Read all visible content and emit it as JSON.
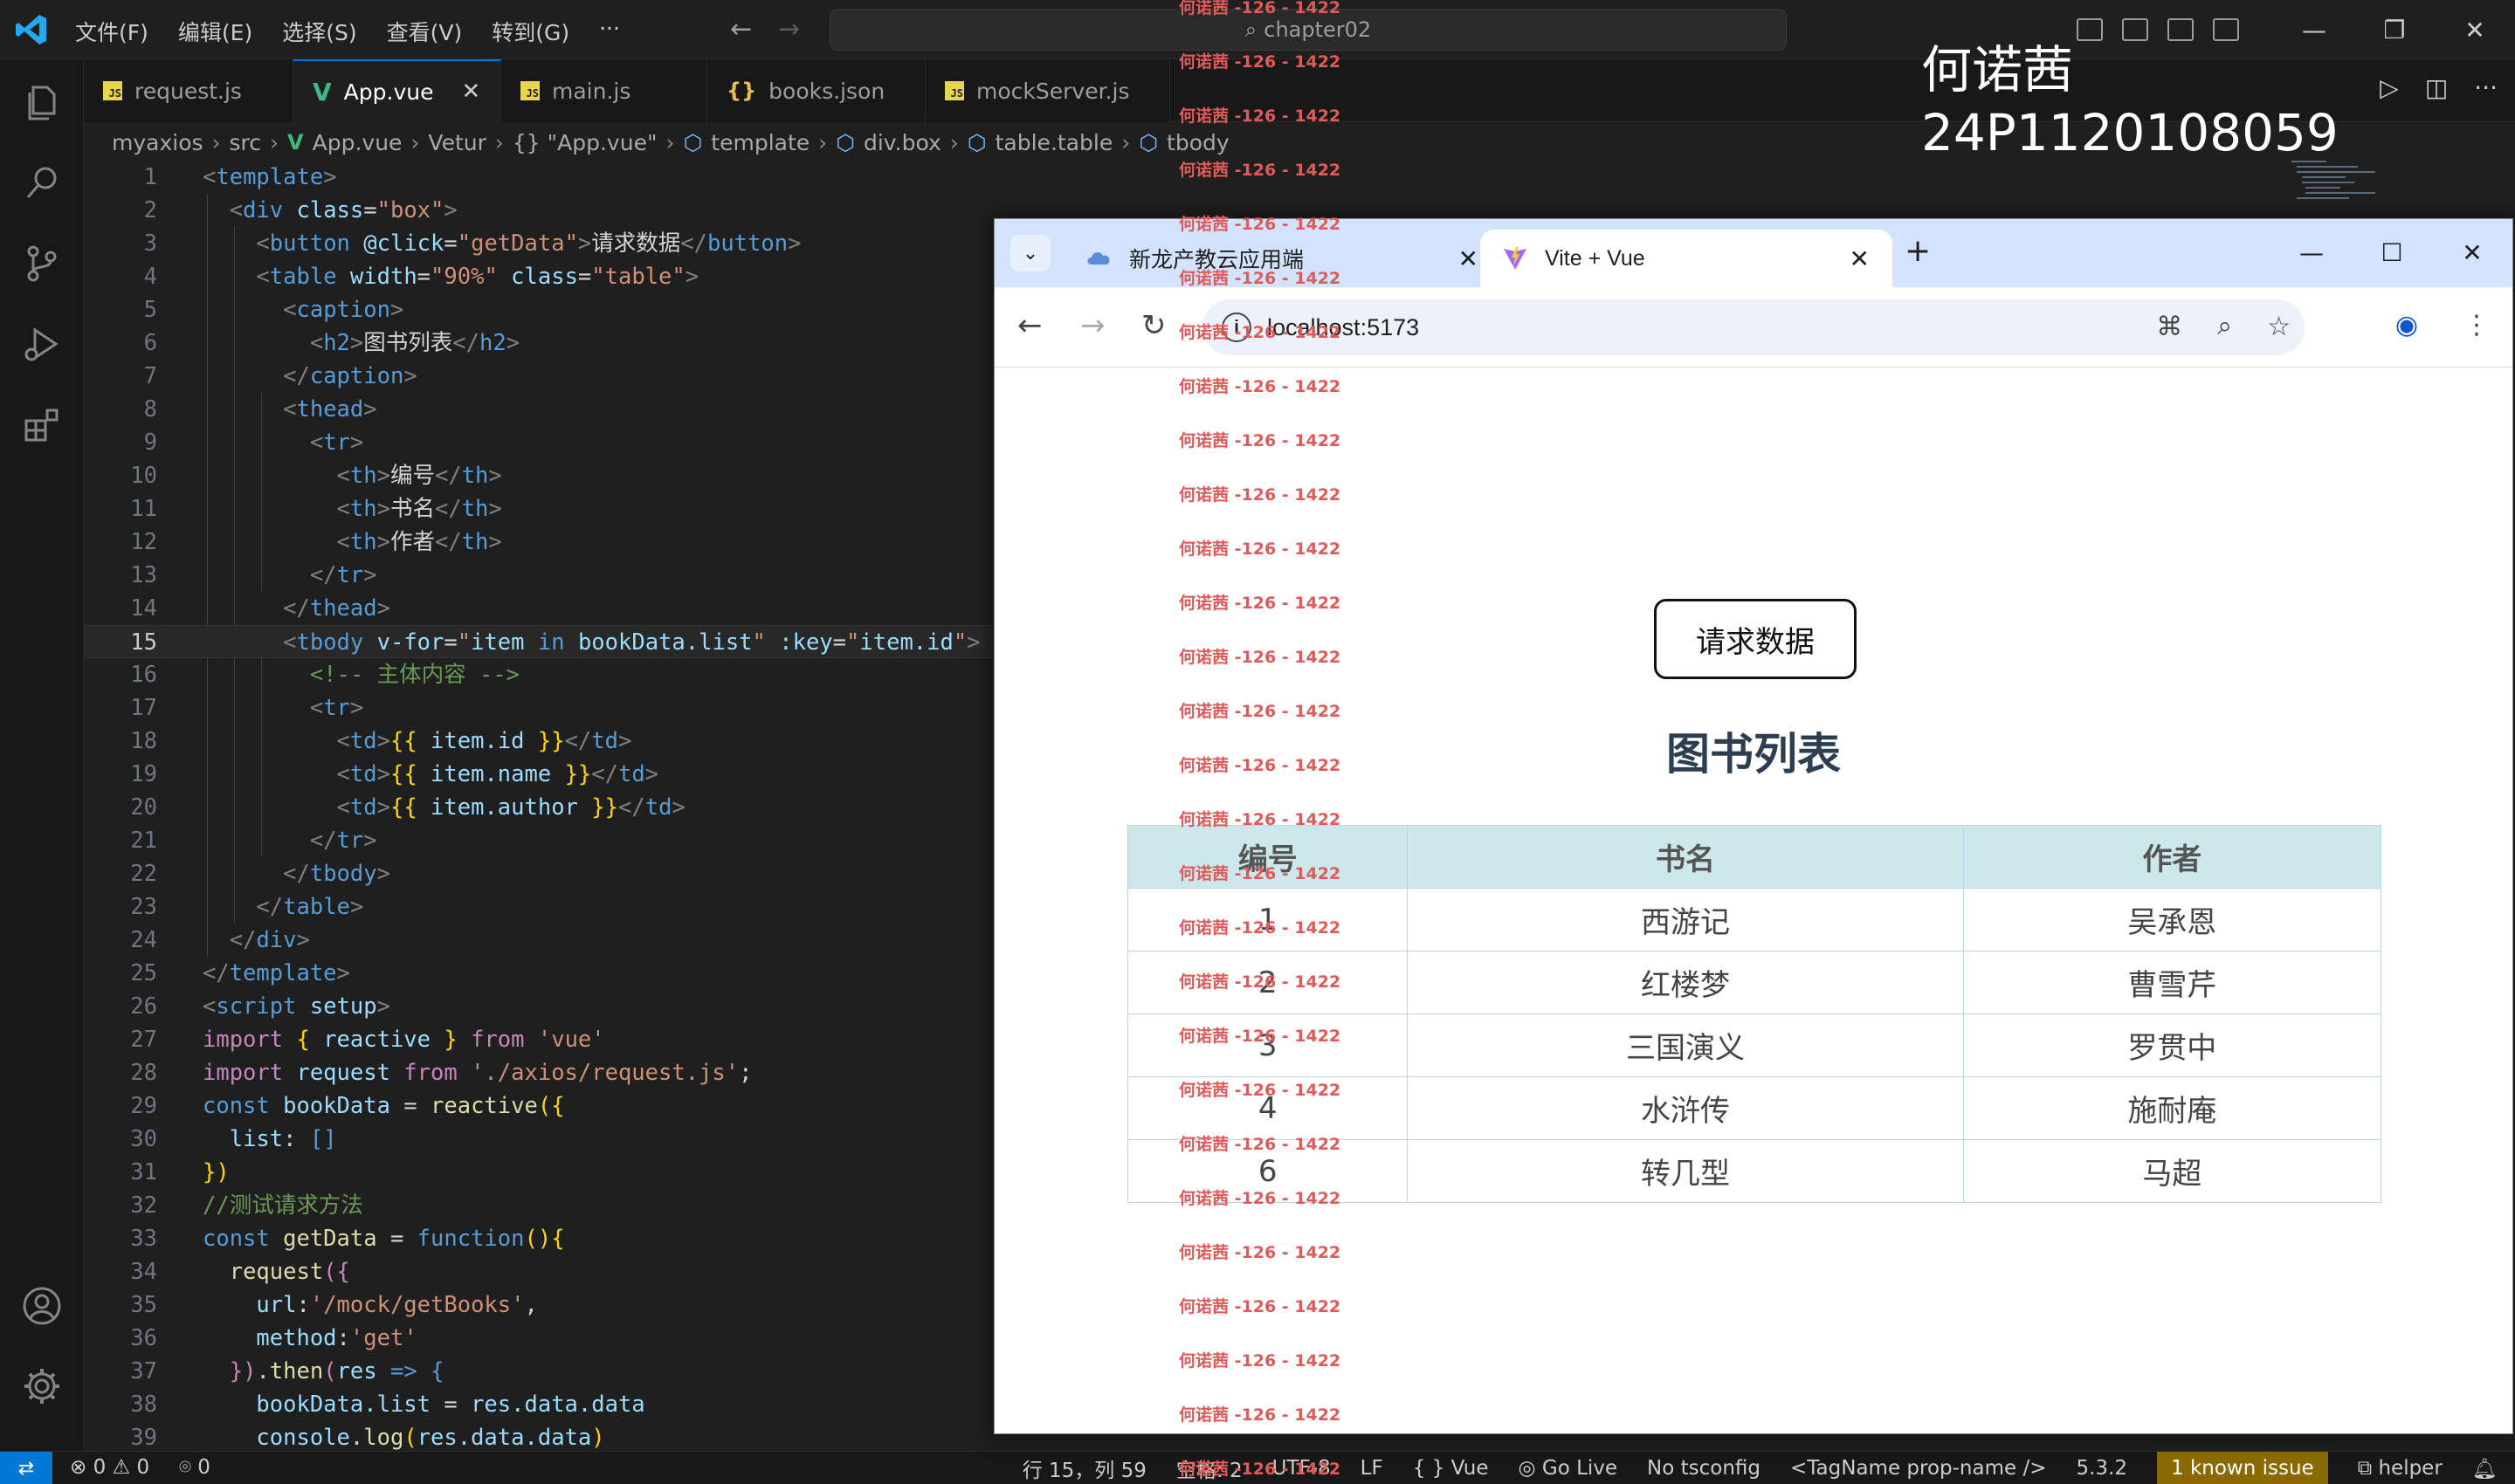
{
  "window": {
    "command_center": "chapter02"
  },
  "menu": [
    "文件(F)",
    "编辑(E)",
    "选择(S)",
    "查看(V)",
    "转到(G)",
    "···"
  ],
  "overlay": {
    "name": "何诺茜",
    "id": "24P1120108059"
  },
  "editor_tabs": [
    {
      "label": "request.js",
      "icon": "js-file-icon"
    },
    {
      "label": "App.vue",
      "icon": "vue-file-icon",
      "active": true
    },
    {
      "label": "main.js",
      "icon": "js-file-icon"
    },
    {
      "label": "books.json",
      "icon": "json-file-icon"
    },
    {
      "label": "mockServer.js",
      "icon": "js-file-icon"
    }
  ],
  "breadcrumb": [
    "myaxios",
    "src",
    "App.vue",
    "Vetur",
    "{} \"App.vue\"",
    "template",
    "div.box",
    "table.table",
    "tbody"
  ],
  "code_lines": [
    [
      [
        "br",
        "<"
      ],
      [
        "tag",
        "template"
      ],
      [
        "br",
        ">"
      ]
    ],
    [
      [
        "t",
        "  "
      ],
      [
        "br",
        "<"
      ],
      [
        "tag",
        "div"
      ],
      [
        "t",
        " "
      ],
      [
        "attr",
        "class"
      ],
      [
        "t",
        "="
      ],
      [
        "str",
        "\"box\""
      ],
      [
        "br",
        ">"
      ]
    ],
    [
      [
        "t",
        "    "
      ],
      [
        "br",
        "<"
      ],
      [
        "tag",
        "button"
      ],
      [
        "t",
        " "
      ],
      [
        "attr",
        "@click"
      ],
      [
        "t",
        "="
      ],
      [
        "str",
        "\"getData\""
      ],
      [
        "br",
        ">"
      ],
      [
        "t",
        "请求数据"
      ],
      [
        "br",
        "</"
      ],
      [
        "tag",
        "button"
      ],
      [
        "br",
        ">"
      ]
    ],
    [
      [
        "t",
        "    "
      ],
      [
        "br",
        "<"
      ],
      [
        "tag",
        "table"
      ],
      [
        "t",
        " "
      ],
      [
        "attr",
        "width"
      ],
      [
        "t",
        "="
      ],
      [
        "str",
        "\"90%\""
      ],
      [
        "t",
        " "
      ],
      [
        "attr",
        "class"
      ],
      [
        "t",
        "="
      ],
      [
        "str",
        "\"table\""
      ],
      [
        "br",
        ">"
      ]
    ],
    [
      [
        "t",
        "      "
      ],
      [
        "br",
        "<"
      ],
      [
        "tag",
        "caption"
      ],
      [
        "br",
        ">"
      ]
    ],
    [
      [
        "t",
        "        "
      ],
      [
        "br",
        "<"
      ],
      [
        "tag",
        "h2"
      ],
      [
        "br",
        ">"
      ],
      [
        "t",
        "图书列表"
      ],
      [
        "br",
        "</"
      ],
      [
        "tag",
        "h2"
      ],
      [
        "br",
        ">"
      ]
    ],
    [
      [
        "t",
        "      "
      ],
      [
        "br",
        "</"
      ],
      [
        "tag",
        "caption"
      ],
      [
        "br",
        ">"
      ]
    ],
    [
      [
        "t",
        "      "
      ],
      [
        "br",
        "<"
      ],
      [
        "tag",
        "thead"
      ],
      [
        "br",
        ">"
      ]
    ],
    [
      [
        "t",
        "        "
      ],
      [
        "br",
        "<"
      ],
      [
        "tag",
        "tr"
      ],
      [
        "br",
        ">"
      ]
    ],
    [
      [
        "t",
        "          "
      ],
      [
        "br",
        "<"
      ],
      [
        "tag",
        "th"
      ],
      [
        "br",
        ">"
      ],
      [
        "t",
        "编号"
      ],
      [
        "br",
        "</"
      ],
      [
        "tag",
        "th"
      ],
      [
        "br",
        ">"
      ]
    ],
    [
      [
        "t",
        "          "
      ],
      [
        "br",
        "<"
      ],
      [
        "tag",
        "th"
      ],
      [
        "br",
        ">"
      ],
      [
        "t",
        "书名"
      ],
      [
        "br",
        "</"
      ],
      [
        "tag",
        "th"
      ],
      [
        "br",
        ">"
      ]
    ],
    [
      [
        "t",
        "          "
      ],
      [
        "br",
        "<"
      ],
      [
        "tag",
        "th"
      ],
      [
        "br",
        ">"
      ],
      [
        "t",
        "作者"
      ],
      [
        "br",
        "</"
      ],
      [
        "tag",
        "th"
      ],
      [
        "br",
        ">"
      ]
    ],
    [
      [
        "t",
        "        "
      ],
      [
        "br",
        "</"
      ],
      [
        "tag",
        "tr"
      ],
      [
        "br",
        ">"
      ]
    ],
    [
      [
        "t",
        "      "
      ],
      [
        "br",
        "</"
      ],
      [
        "tag",
        "thead"
      ],
      [
        "br",
        ">"
      ]
    ],
    [
      [
        "t",
        "      "
      ],
      [
        "br",
        "<"
      ],
      [
        "tag",
        "tbody"
      ],
      [
        "t",
        " "
      ],
      [
        "attr",
        "v-for"
      ],
      [
        "t",
        "="
      ],
      [
        "str",
        "\""
      ],
      [
        "var",
        "item"
      ],
      [
        "kw2",
        " in "
      ],
      [
        "var",
        "bookData.list"
      ],
      [
        "str",
        "\""
      ],
      [
        "t",
        " "
      ],
      [
        "attr",
        ":key"
      ],
      [
        "t",
        "="
      ],
      [
        "str",
        "\""
      ],
      [
        "var",
        "item.id"
      ],
      [
        "str",
        "\""
      ],
      [
        "br",
        ">"
      ]
    ],
    [
      [
        "t",
        "        "
      ],
      [
        "cmt",
        "<!-- 主体内容 -->"
      ]
    ],
    [
      [
        "t",
        "        "
      ],
      [
        "br",
        "<"
      ],
      [
        "tag",
        "tr"
      ],
      [
        "br",
        ">"
      ]
    ],
    [
      [
        "t",
        "          "
      ],
      [
        "br",
        "<"
      ],
      [
        "tag",
        "td"
      ],
      [
        "br",
        ">"
      ],
      [
        "mus",
        "{{"
      ],
      [
        "var",
        " item.id "
      ],
      [
        "mus",
        "}}"
      ],
      [
        "br",
        "</"
      ],
      [
        "tag",
        "td"
      ],
      [
        "br",
        ">"
      ]
    ],
    [
      [
        "t",
        "          "
      ],
      [
        "br",
        "<"
      ],
      [
        "tag",
        "td"
      ],
      [
        "br",
        ">"
      ],
      [
        "mus",
        "{{"
      ],
      [
        "var",
        " item.name "
      ],
      [
        "mus",
        "}}"
      ],
      [
        "br",
        "</"
      ],
      [
        "tag",
        "td"
      ],
      [
        "br",
        ">"
      ]
    ],
    [
      [
        "t",
        "          "
      ],
      [
        "br",
        "<"
      ],
      [
        "tag",
        "td"
      ],
      [
        "br",
        ">"
      ],
      [
        "mus",
        "{{"
      ],
      [
        "var",
        " item.author "
      ],
      [
        "mus",
        "}}"
      ],
      [
        "br",
        "</"
      ],
      [
        "tag",
        "td"
      ],
      [
        "br",
        ">"
      ]
    ],
    [
      [
        "t",
        "        "
      ],
      [
        "br",
        "</"
      ],
      [
        "tag",
        "tr"
      ],
      [
        "br",
        ">"
      ]
    ],
    [
      [
        "t",
        "      "
      ],
      [
        "br",
        "</"
      ],
      [
        "tag",
        "tbody"
      ],
      [
        "br",
        ">"
      ]
    ],
    [
      [
        "t",
        "    "
      ],
      [
        "br",
        "</"
      ],
      [
        "tag",
        "table"
      ],
      [
        "br",
        ">"
      ]
    ],
    [
      [
        "t",
        "  "
      ],
      [
        "br",
        "</"
      ],
      [
        "tag",
        "div"
      ],
      [
        "br",
        ">"
      ]
    ],
    [
      [
        "br",
        "</"
      ],
      [
        "tag",
        "template"
      ],
      [
        "br",
        ">"
      ]
    ],
    [
      [
        "br",
        "<"
      ],
      [
        "tag",
        "script"
      ],
      [
        "t",
        " "
      ],
      [
        "attr",
        "setup"
      ],
      [
        "br",
        ">"
      ]
    ],
    [
      [
        "kw",
        "import"
      ],
      [
        "t",
        " "
      ],
      [
        "mus",
        "{"
      ],
      [
        "var",
        " reactive "
      ],
      [
        "mus",
        "}"
      ],
      [
        "t",
        " "
      ],
      [
        "kw",
        "from"
      ],
      [
        "t",
        " "
      ],
      [
        "str",
        "'vue'"
      ]
    ],
    [
      [
        "kw",
        "import"
      ],
      [
        "var",
        " request "
      ],
      [
        "kw",
        "from"
      ],
      [
        "t",
        " "
      ],
      [
        "str",
        "'./axios/request.js'"
      ],
      [
        "t",
        ";"
      ]
    ],
    [
      [
        "kw2",
        "const"
      ],
      [
        "var",
        " bookData "
      ],
      [
        "t",
        "= "
      ],
      [
        "fn",
        "reactive"
      ],
      [
        "mus",
        "({"
      ]
    ],
    [
      [
        "t",
        "  "
      ],
      [
        "var",
        "list"
      ],
      [
        "t",
        ": "
      ],
      [
        "kw2",
        "[]"
      ]
    ],
    [
      [
        "mus",
        "})"
      ]
    ],
    [
      [
        "cmt",
        "//测试请求方法"
      ]
    ],
    [
      [
        "kw2",
        "const"
      ],
      [
        "t",
        " "
      ],
      [
        "fn",
        "getData"
      ],
      [
        "t",
        " = "
      ],
      [
        "kw2",
        "function"
      ],
      [
        "mus",
        "(){"
      ]
    ],
    [
      [
        "t",
        "  "
      ],
      [
        "fn",
        "request"
      ],
      [
        "kw",
        "({"
      ]
    ],
    [
      [
        "t",
        "    "
      ],
      [
        "var",
        "url"
      ],
      [
        "t",
        ":"
      ],
      [
        "str",
        "'/mock/getBooks'"
      ],
      [
        "t",
        ","
      ]
    ],
    [
      [
        "t",
        "    "
      ],
      [
        "var",
        "method"
      ],
      [
        "t",
        ":"
      ],
      [
        "str",
        "'get'"
      ]
    ],
    [
      [
        "t",
        "  "
      ],
      [
        "kw",
        "})"
      ],
      [
        "t",
        "."
      ],
      [
        "fn",
        "then"
      ],
      [
        "kw",
        "("
      ],
      [
        "var",
        "res"
      ],
      [
        "t",
        " "
      ],
      [
        "kw2",
        "=>"
      ],
      [
        "t",
        " "
      ],
      [
        "kw2",
        "{"
      ]
    ],
    [
      [
        "t",
        "    "
      ],
      [
        "var",
        "bookData.list"
      ],
      [
        "t",
        " = "
      ],
      [
        "var",
        "res.data.data"
      ]
    ],
    [
      [
        "t",
        "    "
      ],
      [
        "var",
        "console"
      ],
      [
        "t",
        "."
      ],
      [
        "fn",
        "log"
      ],
      [
        "mus",
        "("
      ],
      [
        "var",
        "res.data.data"
      ],
      [
        "mus",
        ")"
      ]
    ]
  ],
  "current_line": 15,
  "watermark": "何诺茜 -126 - 1422",
  "browser": {
    "tabs": [
      {
        "title": "新龙产教云应用端",
        "icon": "cloud-favicon-icon"
      },
      {
        "title": "Vite + Vue",
        "icon": "vite-favicon-icon",
        "active": true
      }
    ],
    "url": "localhost:5173",
    "page": {
      "button_label": "请求数据",
      "title": "图书列表",
      "table": {
        "headers": [
          "编号",
          "书名",
          "作者"
        ],
        "rows": [
          [
            "1",
            "西游记",
            "吴承恩"
          ],
          [
            "2",
            "红楼梦",
            "曹雪芹"
          ],
          [
            "3",
            "三国演义",
            "罗贯中"
          ],
          [
            "4",
            "水浒传",
            "施耐庵"
          ],
          [
            "6",
            "转几型",
            "马超"
          ]
        ]
      }
    }
  },
  "statusbar": {
    "errors": "0",
    "warnings": "0",
    "ports": "0",
    "position": "行 15，列 59",
    "spaces": "空格: 2",
    "encoding": "UTF-8",
    "eol": "LF",
    "language": "Vue",
    "golive": "Go Live",
    "tsconfig": "No tsconfig",
    "tagname": "<TagName prop-name />",
    "version": "5.3.2",
    "issue": "1 known issue",
    "helper": "helper"
  },
  "colors": {
    "accent": "#0078d4",
    "vue_green": "#41b883",
    "table_header_bg": "#cde8ea",
    "watermark": "#e05a5a"
  }
}
